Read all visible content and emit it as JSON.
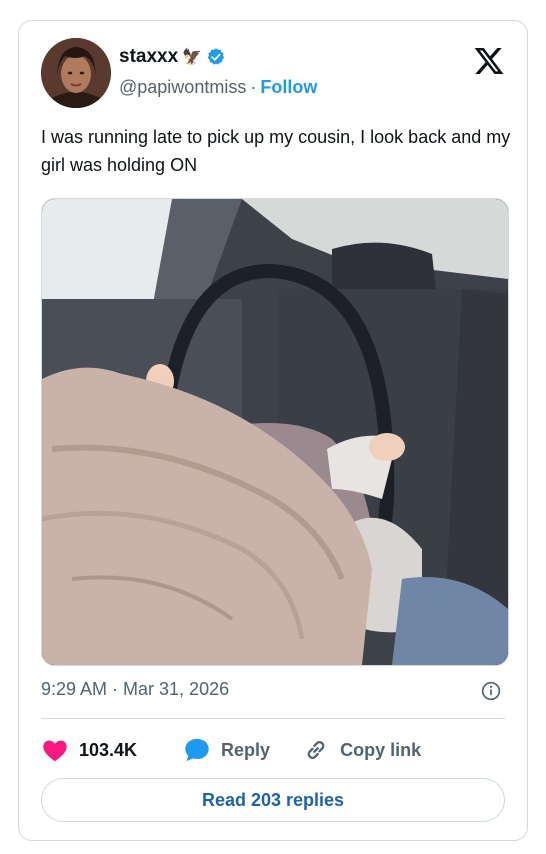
{
  "tweet": {
    "author_name": "staxxx",
    "author_emoji": "🦅",
    "handle": "@papiwontmiss",
    "separator": "·",
    "follow_label": "Follow",
    "text": "I was running late to pick up my cousin, I look back and my girl was holding ON",
    "timestamp": "9:29 AM · Mar 31, 2026",
    "likes": "103.4K",
    "reply_label": "Reply",
    "copy_link_label": "Copy link",
    "read_replies_label": "Read 203 replies"
  },
  "icons": {
    "verified": "verified-badge-icon",
    "logo": "x-logo-icon",
    "info": "info-icon",
    "like": "heart-icon",
    "reply": "speech-bubble-icon",
    "link": "link-icon"
  },
  "colors": {
    "accent": "#1d9bf0",
    "like": "#f91880",
    "muted": "#536471",
    "border": "#cfd9de"
  }
}
